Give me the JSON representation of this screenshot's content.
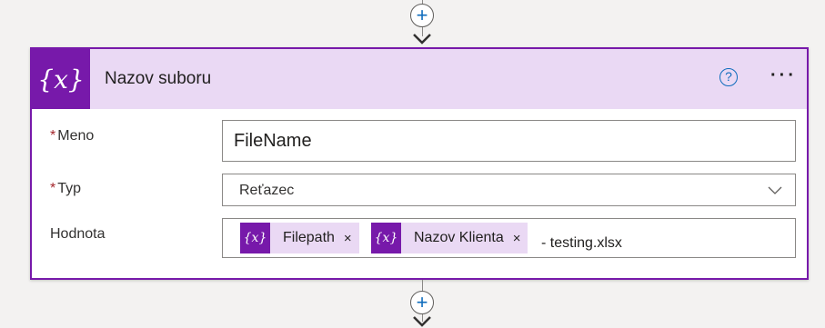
{
  "card": {
    "icon_symbol": "{x}",
    "title": "Nazov suboru",
    "help_symbol": "?",
    "more_symbol": "···"
  },
  "connectors": {
    "add_symbol": "+"
  },
  "fields": {
    "name": {
      "required_mark": "*",
      "label": "Meno",
      "value": "FileName"
    },
    "type": {
      "required_mark": "*",
      "label": "Typ",
      "value": "Reťazec"
    },
    "value": {
      "label": "Hodnota",
      "tokens": [
        {
          "icon_symbol": "{x}",
          "label": "Filepath",
          "close": "×"
        },
        {
          "icon_symbol": "{x}",
          "label": "Nazov Klienta",
          "close": "×"
        }
      ],
      "suffix": "- testing.xlsx"
    }
  },
  "colors": {
    "accent": "#7719aa",
    "header_bg": "#ead9f4",
    "link": "#0f6cbd"
  }
}
